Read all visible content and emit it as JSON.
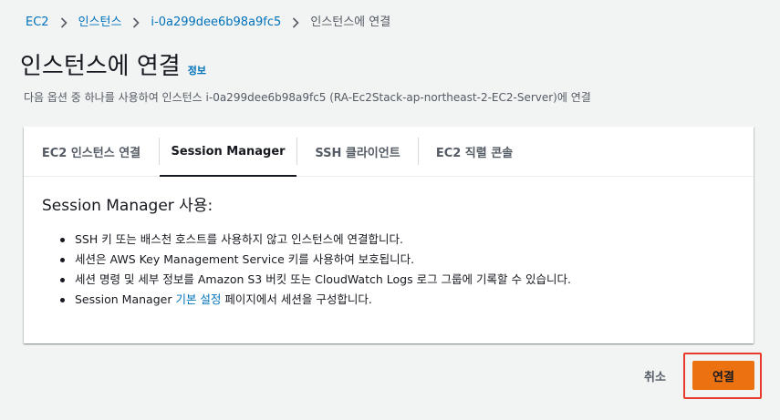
{
  "breadcrumb": {
    "items": [
      "EC2",
      "인스턴스",
      "i-0a299dee6b98a9fc5"
    ],
    "current": "인스턴스에 연결"
  },
  "header": {
    "title": "인스턴스에 연결",
    "info_link": "정보",
    "description": "다음 옵션 중 하나를 사용하여 인스턴스 i-0a299dee6b98a9fc5 (RA-Ec2Stack-ap-northeast-2-EC2-Server)에 연결"
  },
  "tabs": [
    {
      "label": "EC2 인스턴스 연결",
      "active": false
    },
    {
      "label": "Session Manager",
      "active": true
    },
    {
      "label": "SSH 클라이언트",
      "active": false
    },
    {
      "label": "EC2 직렬 콘솔",
      "active": false
    }
  ],
  "session_manager": {
    "heading": "Session Manager 사용:",
    "bullets": [
      "SSH 키 또는 배스천 호스트를 사용하지 않고 인스턴스에 연결합니다.",
      "세션은 AWS Key Management Service 키를 사용하여 보호됩니다.",
      "세션 명령 및 세부 정보를 Amazon S3 버킷 또는 CloudWatch Logs 로그 그룹에 기록할 수 있습니다."
    ],
    "last_bullet": {
      "prefix": "Session Manager ",
      "link": "기본 설정",
      "suffix": " 페이지에서 세션을 구성합니다."
    }
  },
  "footer": {
    "cancel_label": "취소",
    "connect_label": "연결"
  },
  "colors": {
    "primary_button": "#ec7211",
    "link": "#0073bb",
    "highlight": "#e83a2c"
  }
}
